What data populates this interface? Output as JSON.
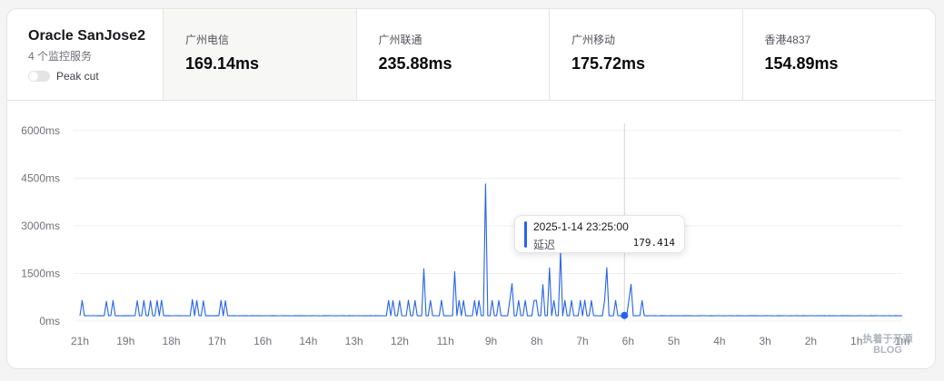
{
  "server": {
    "name": "Oracle SanJose2",
    "service_count": "4 个监控服务",
    "peak_cut_label": "Peak cut",
    "peak_cut_enabled": false
  },
  "stats": [
    {
      "label": "广州电信",
      "value": "169.14ms",
      "active": true
    },
    {
      "label": "广州联通",
      "value": "235.88ms",
      "active": false
    },
    {
      "label": "广州移动",
      "value": "175.72ms",
      "active": false
    },
    {
      "label": "香港4837",
      "value": "154.89ms",
      "active": false
    }
  ],
  "tooltip": {
    "time": "2025-1-14 23:25:00",
    "label": "延迟",
    "value": "179.414"
  },
  "watermark": {
    "line1": "执着于开源",
    "line2": "BLOG"
  },
  "colors": {
    "series": "#2563eb",
    "grid": "#f0f0f0",
    "border": "#e4e4e7"
  },
  "chart_data": {
    "type": "line",
    "series": [
      {
        "values": [
          170,
          650,
          170,
          170,
          175,
          168,
          172,
          171,
          169,
          173,
          170,
          168,
          620,
          170,
          172,
          650,
          169,
          170,
          171,
          168,
          172,
          170,
          173,
          169,
          170,
          171,
          640,
          168,
          170,
          650,
          172,
          169,
          640,
          170,
          168,
          650,
          171,
          660,
          170,
          169,
          172,
          170,
          168,
          171,
          173,
          169,
          170,
          171,
          172,
          168,
          170,
          680,
          169,
          650,
          171,
          170,
          640,
          168,
          172,
          170,
          171,
          169,
          173,
          170,
          650,
          168,
          640,
          171,
          170,
          169,
          172,
          168,
          170,
          171,
          169,
          173,
          170,
          168,
          172,
          170,
          171,
          169,
          170,
          168,
          172,
          171,
          170,
          169,
          173,
          170,
          168,
          171,
          172,
          169,
          170,
          171,
          168,
          170,
          172,
          169,
          173,
          170,
          171,
          168,
          170,
          169,
          172,
          171,
          170,
          168,
          169,
          173,
          170,
          172,
          171,
          168,
          170,
          169,
          171,
          172,
          170,
          168,
          173,
          169,
          170,
          171,
          172,
          168,
          170,
          169,
          171,
          170,
          173,
          168,
          172,
          169,
          170,
          171,
          168,
          170,
          650,
          172,
          650,
          169,
          170,
          640,
          171,
          168,
          170,
          660,
          169,
          172,
          650,
          170,
          171,
          168,
          1650,
          169,
          170,
          650,
          172,
          171,
          168,
          170,
          660,
          169,
          170,
          171,
          168,
          170,
          1560,
          172,
          650,
          169,
          650,
          170,
          171,
          168,
          170,
          650,
          169,
          650,
          172,
          170,
          4320,
          171,
          168,
          650,
          170,
          169,
          650,
          172,
          170,
          171,
          168,
          650,
          1180,
          169,
          170,
          650,
          171,
          172,
          650,
          168,
          170,
          169,
          650,
          660,
          171,
          170,
          1150,
          168,
          172,
          1680,
          169,
          650,
          170,
          171,
          2180,
          168,
          650,
          170,
          169,
          650,
          172,
          171,
          170,
          650,
          168,
          660,
          169,
          170,
          650,
          171,
          172,
          168,
          170,
          169,
          650,
          1680,
          170,
          171,
          168,
          650,
          172,
          169,
          170,
          171,
          168,
          650,
          1160,
          170,
          169,
          172,
          171,
          650,
          168,
          170,
          169,
          171,
          172,
          170,
          168,
          169,
          173,
          170,
          171,
          168,
          172,
          170,
          169,
          171,
          170,
          168,
          173,
          169,
          172,
          170,
          171,
          168,
          170,
          169,
          172,
          171,
          170,
          168,
          173,
          169,
          170,
          171,
          172,
          168,
          170,
          169,
          171,
          173,
          170,
          168,
          172,
          169,
          170,
          171,
          168,
          170,
          172,
          169,
          173,
          170,
          171,
          168,
          170,
          169,
          172,
          171,
          170,
          168,
          169,
          173,
          170,
          172,
          171,
          168,
          170,
          169,
          171,
          172,
          170,
          168,
          173,
          169,
          170,
          171,
          172,
          168,
          170,
          169,
          171,
          170,
          173,
          168,
          172,
          169,
          170,
          171,
          168,
          170,
          172,
          169,
          173,
          170,
          171,
          168,
          170,
          169,
          172,
          171,
          170,
          168,
          169,
          173,
          170,
          172,
          171,
          168,
          170,
          169,
          171,
          172,
          170,
          168,
          173,
          169,
          170,
          171
        ]
      }
    ],
    "x_ticks": [
      "21h",
      "19h",
      "18h",
      "17h",
      "16h",
      "14h",
      "13h",
      "12h",
      "11h",
      "9h",
      "8h",
      "7h",
      "6h",
      "5h",
      "4h",
      "3h",
      "2h",
      "1h",
      "1m"
    ],
    "y_ticks": [
      "6000ms",
      "4500ms",
      "3000ms",
      "1500ms",
      "0ms"
    ],
    "ylim": [
      0,
      6000
    ],
    "grid": true,
    "highlight_index": 247,
    "highlight_value": 179.414
  }
}
